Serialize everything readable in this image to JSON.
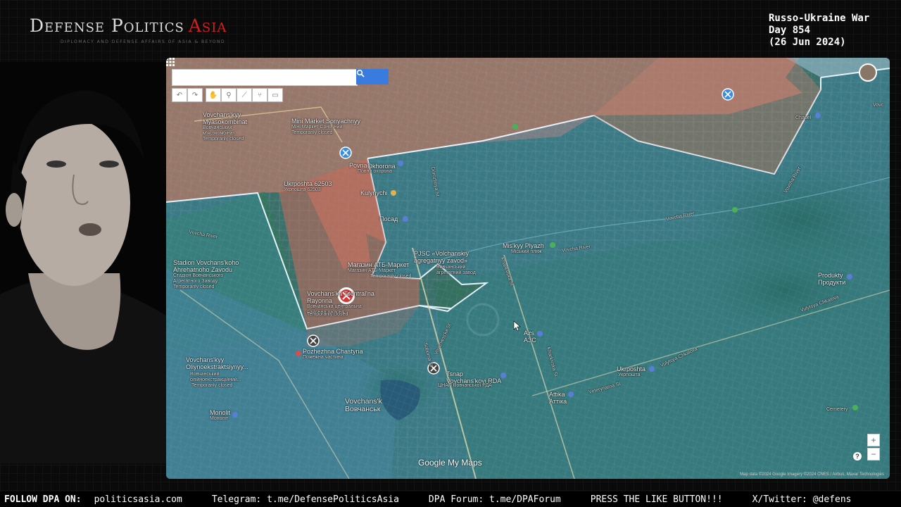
{
  "header": {
    "logo_main": "Defense Politics",
    "logo_accent": "Asia",
    "logo_sub": "DIPLOMACY AND DEFENSE AFFAIRS OF ASIA & BEYOND",
    "war_line1": "Russo-Ukraine War",
    "war_line2": "Day 854",
    "war_line3": "(26 Jun 2024)"
  },
  "map": {
    "search_placeholder": "",
    "toolbar": [
      "undo-icon",
      "redo-icon",
      "hand-icon",
      "marker-icon",
      "line-icon",
      "route-icon",
      "ruler-icon"
    ],
    "labels": {
      "myasokombinat": "Vovchans'kyy\nMyasokombinat",
      "myasokombinat_ua": "Вовчанський\nм'ясокомбінат",
      "myasokombinat_status": "Temporarily closed",
      "minimarket": "Mini Market Sonyachnyy",
      "minimarket_ua": "Міні Маркет Сонячний",
      "minimarket_status": "Temporarily closed",
      "povna": "Povna",
      "povna_ua": "Повна",
      "okhorona": "Okhorona",
      "okhorona_ua": "Повна охорона",
      "ukrposhta1": "Ukrposhta 62503",
      "ukrposhta1_ua": "Укрпошта 62503",
      "kulynychi": "Kulynychi",
      "posad": "Посад",
      "pjsc": "PJSC «Volchanskiy\nagregatnyy zavod»",
      "pjsc_ua": "Вовчанський\nагрегатний завод",
      "magazyn": "Магазин АТБ-Маркет",
      "magazyn_ua": "Магазин АТБ-Маркет",
      "magazyn_status": "Temporarily closed",
      "vovchans_central": "Vovchans'ka Tsentral'na\nRayonna",
      "vovchans_central_ua": "Вовчанська центральна\nрайонна лікарня",
      "vovchans_central_status": "Temporarily closed",
      "stadion": "Stadion Vovchans'koho\nAhrehatnoho Zavodu",
      "stadion_ua": "Стадіон Вовчанського\nАгрегатного Заводу",
      "stadion_status": "Temporarily closed",
      "pozhezhna": "Pozhezhna Chastyna",
      "pozhezhna_ua": "Пожежна частина",
      "olijnyi": "Vovchans'kyy\nOliynoekstraktsiynyy...",
      "olijnyi_ua": "Вовчанський\nолійноекстракційний...",
      "olijnyi_status": "Temporarily closed",
      "monolit": "Monolit",
      "monolit_ua": "Моноліт",
      "vovchansk": "Vovchans'k",
      "vovchansk_ua": "Вовчанськ",
      "miskyy_plyazh": "Mis'kyy Plyazh",
      "miskyy_plyazh_ua": "Міський пляж",
      "vovcha_river1": "Vovcha River",
      "vovcha_river2": "Vovcha River",
      "vovcha_river3": "Vovcha River",
      "vovcha_river4": "Vovcha River",
      "tsnap": "Tsnap\nVovchans'koyi RDA",
      "tsnap_ua": "ЦНАП Вовчанської РДА",
      "azs": "Azs\nАЗС",
      "ukrposhta2": "Ukrposhta",
      "ukrposhta2_ua": "Укрпошта",
      "attika": "Attika\nАттіка",
      "produkty": "Produkty\nПродукти",
      "chapel": "Chapel",
      "cemetery": "Cemetery",
      "chkalova1": "Vulytsya Chkalova",
      "chkalova2": "Vulytsya Chkalova",
      "veterynarna": "Veterynarna St",
      "kharkivska1": "Kharkivska St",
      "kharkivska2": "Kharkivska St",
      "soborna": "Soborna St",
      "doroga": "Dorozhnya St",
      "vovchans_st": "Vovchans'ka St",
      "vovchansk_top_right": "Vovc"
    },
    "attribution": "Map data ©2024 Google Imagery ©2024 CNES / Airbus, Maxar Technologies",
    "brand": "Google My Maps",
    "zoom_in": "+",
    "zoom_out": "−",
    "help": "?"
  },
  "ticker": {
    "lead": "FOLLOW DPA ON:",
    "items": [
      "politicsasia.com",
      "Telegram: t.me/DefensePoliticsAsia",
      "DPA Forum: t.me/DPAForum",
      "PRESS THE LIKE BUTTON!!!",
      "X/Twitter: @defens"
    ]
  },
  "colors": {
    "ukraine_zone": "#3f8fb8",
    "russia_zone": "#c86a5a",
    "accent_red": "#d21f1f",
    "search_btn": "#3a7be0"
  }
}
